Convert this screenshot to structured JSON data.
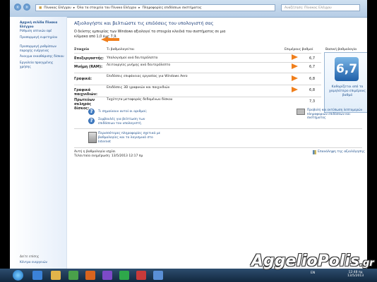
{
  "window": {
    "breadcrumb": [
      "Πίνακας Ελέγχου",
      "Όλα τα στοιχεία του Πίνακα Ελέγχου",
      "Πληροφορίες επιδόσεων συστήματος"
    ],
    "search_placeholder": "Αναζήτηση: Πίνακας Ελέγχου"
  },
  "sidebar": {
    "items": [
      "Αρχική σελίδα Πίνακα Ελέγχου",
      "Ρύθμιση οπτικών εφέ",
      "Προσαρμογή ευρετηρίου",
      "Προσαρμογή ρυθμίσεων παροχής ενέργειας",
      "Άνοιγμα εκκαθάρισης δίσκου",
      "Εργαλεία προηγμένης χρήσης"
    ],
    "see_also": "Δείτε επίσης",
    "footer_link": "Κέντρο ενεργειών"
  },
  "main": {
    "title": "Αξιολογήστε και βελτιώστε τις επιδόσεις του υπολογιστή σας",
    "intro": "Ο δείκτης εμπειρίας των Windows αξιολογεί τα στοιχεία κλειδιά του συστήματος σε μια κλίμακα από 1,0 έως 7,9.",
    "col_component": "Στοιχείο",
    "col_rated": "Τι βαθμολογείται",
    "col_subscore": "Επιμέρους βαθμοί",
    "col_base": "Βασική βαθμολογία",
    "rows": [
      {
        "name": "Επεξεργαστής:",
        "desc": "Υπολογισμοί ανά δευτερόλεπτο",
        "score": "6,7"
      },
      {
        "name": "Μνήμη (RAM):",
        "desc": "Λειτουργίες μνήμης ανά δευτερόλεπτο",
        "score": "6,7"
      },
      {
        "name": "Γραφικά:",
        "desc": "Επιδόσεις επιφάνειας εργασίας για Windows Aero",
        "score": "6,8"
      },
      {
        "name": "Γραφικά παιχνιδιών:",
        "desc": "Επιδόσεις 3D γραφικών και παιχνιδιών",
        "score": "6,8"
      },
      {
        "name": "Πρωτεύων σκληρός δίσκος:",
        "desc": "Ταχύτητα μεταφοράς δεδομένων δίσκου",
        "score": "7,3"
      }
    ],
    "base_score": "6,7",
    "base_desc": "Καθορίζεται από το χαμηλότερο επιμέρους βαθμό",
    "link1": "Τι σημαίνουν αυτοί οι αριθμοί;",
    "link2": "Συμβουλές για βελτίωση των επιδόσεων του υπολογιστή",
    "link3": "Περισσότερες πληροφορίες σχετικά με βαθμολογίες και το λογισμικό στο Internet",
    "link_right": "Προβολή και εκτύπωση λεπτομερών πληροφοριών επιδόσεων και συστήματος",
    "status1": "Αυτή η βαθμολογία ισχύει",
    "status2": "Τελευταία ενημέρωση: 13/5/2013 12:17 πμ",
    "rerun": "Επανάληψη της αξιολόγησης"
  },
  "taskbar": {
    "tray_lang": "EN",
    "time": "12:48 πμ",
    "date": "13/5/2013"
  },
  "watermark": {
    "name": "AggelioPolis",
    "tld": ".gr"
  },
  "colors": {
    "link": "#1d4f8c",
    "arrow": "#f07f1c",
    "accent": "#1f5fa8"
  }
}
